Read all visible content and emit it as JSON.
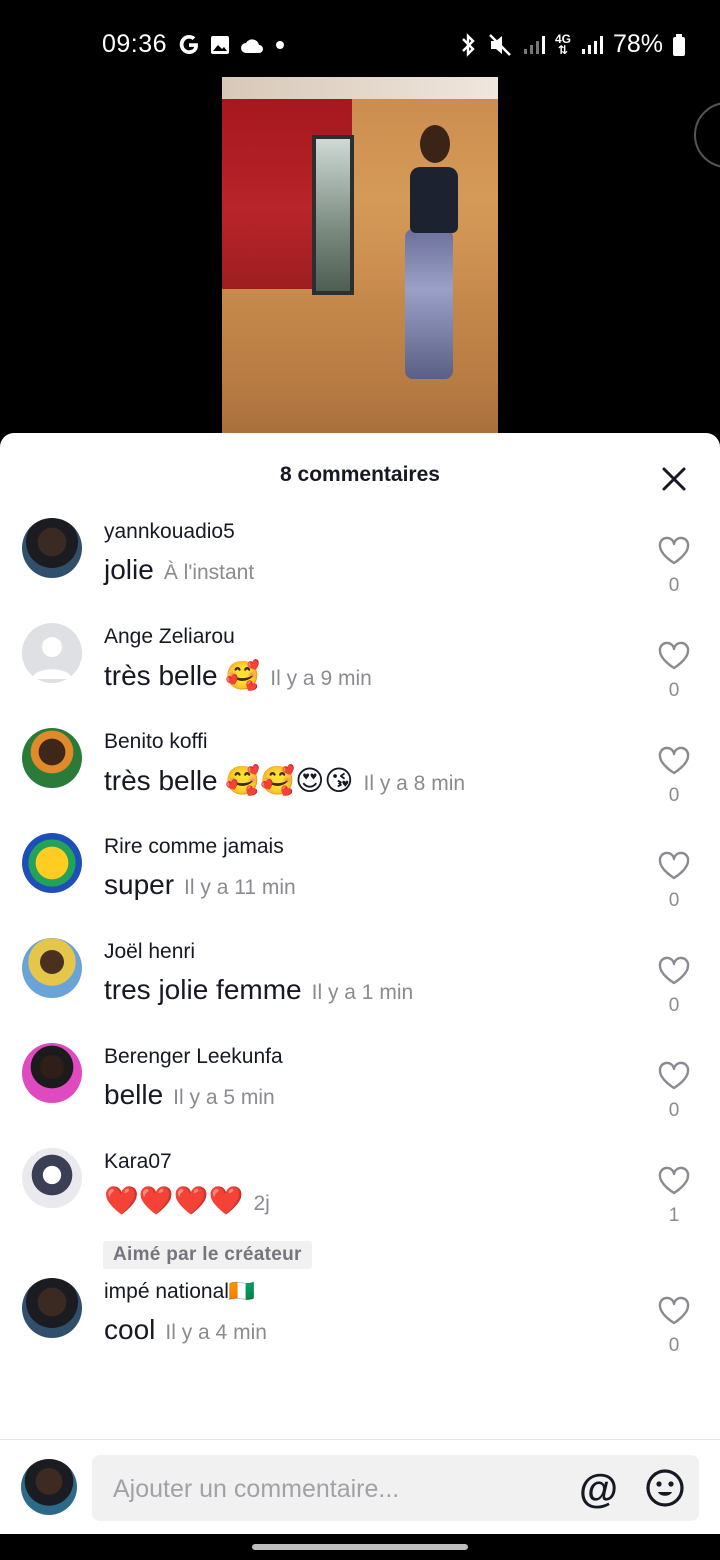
{
  "status_bar": {
    "time": "09:36",
    "battery": "78%",
    "network": "4G"
  },
  "sheet": {
    "title": "8 commentaires",
    "close_icon": "close-icon"
  },
  "comments": [
    {
      "user": "yannkouadio5",
      "text": "jolie",
      "time": "À l'instant",
      "likes": "0",
      "avatar": "av-dark"
    },
    {
      "user": "Ange Zeliarou",
      "text": "très belle 🥰",
      "time": "Il y a 9 min",
      "likes": "0",
      "avatar": "av-default"
    },
    {
      "user": "Benito koffi",
      "text": "très belle 🥰🥰😍😘",
      "time": "Il y a 8 min",
      "likes": "0",
      "avatar": "av-green"
    },
    {
      "user": "Rire comme jamais",
      "text": "super",
      "time": "Il y a 11 min",
      "likes": "0",
      "avatar": "av-laugh"
    },
    {
      "user": "Joël henri",
      "text": "tres jolie femme",
      "time": "Il y a 1 min",
      "likes": "0",
      "avatar": "av-yellow"
    },
    {
      "user": "Berenger Leekunfa",
      "text": "belle",
      "time": "Il y a 5 min",
      "likes": "0",
      "avatar": "av-pink"
    },
    {
      "user": "Kara07",
      "text": "❤️❤️❤️❤️",
      "time": "2j",
      "likes": "1",
      "avatar": "av-white",
      "badge": "Aimé par le créateur"
    },
    {
      "user": "impé national🇨🇮",
      "text": "cool",
      "time": "Il y a 4 min",
      "likes": "0",
      "avatar": "av-dark"
    }
  ],
  "input": {
    "placeholder": "Ajouter un commentaire...",
    "mention": "@"
  }
}
